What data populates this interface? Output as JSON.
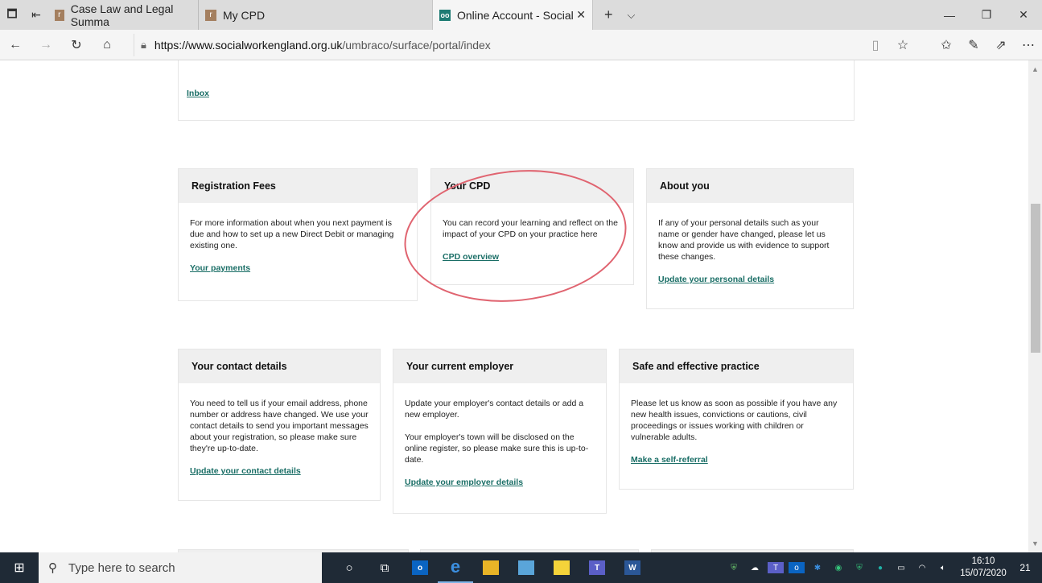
{
  "browser": {
    "tabs": [
      {
        "label": "Case Law and Legal Summa",
        "favicon": "r"
      },
      {
        "label": "My CPD",
        "favicon": "r"
      },
      {
        "label": "Online Account - Social",
        "favicon": "oo",
        "active": true
      }
    ],
    "url_host": "https://www.socialworkengland.org.uk",
    "url_path": "/umbraco/surface/portal/index"
  },
  "page": {
    "inbox_link": "Inbox",
    "cards": [
      {
        "title": "Registration Fees",
        "body": [
          "For more information about when you next payment is due and how to set up a new Direct Debit or managing existing one."
        ],
        "link": "Your payments"
      },
      {
        "title": "Your CPD",
        "body": [
          "You can record your learning and reflect on the impact of your CPD on your practice here"
        ],
        "link": "CPD overview"
      },
      {
        "title": "About you",
        "body": [
          "If any of your personal details such as your name or gender have changed, please let us know and provide us with evidence to support these changes."
        ],
        "link": "Update your personal details"
      },
      {
        "title": "Your contact details",
        "body": [
          "You need to tell us if your email address, phone number or address have changed. We use your contact details to send you important messages about your registration, so please make sure they're up-to-date."
        ],
        "link": "Update your contact details"
      },
      {
        "title": "Your current employer",
        "body": [
          "Update your employer's contact details or add a new employer.",
          "Your employer's town will be disclosed on the online register, so please make sure this is up-to-date."
        ],
        "link": "Update your employer details"
      },
      {
        "title": "Safe and effective practice",
        "body": [
          "Please let us know as soon as possible if you have any new health issues, convictions or cautions, civil proceedings or issues working with children or vulnerable adults."
        ],
        "link": "Make a self-referral"
      }
    ]
  },
  "taskbar": {
    "search_placeholder": "Type here to search",
    "time": "16:10",
    "date": "15/07/2020",
    "notifications": "21"
  },
  "colors": {
    "link": "#1a6e66",
    "highlight_circle": "#e06470"
  }
}
